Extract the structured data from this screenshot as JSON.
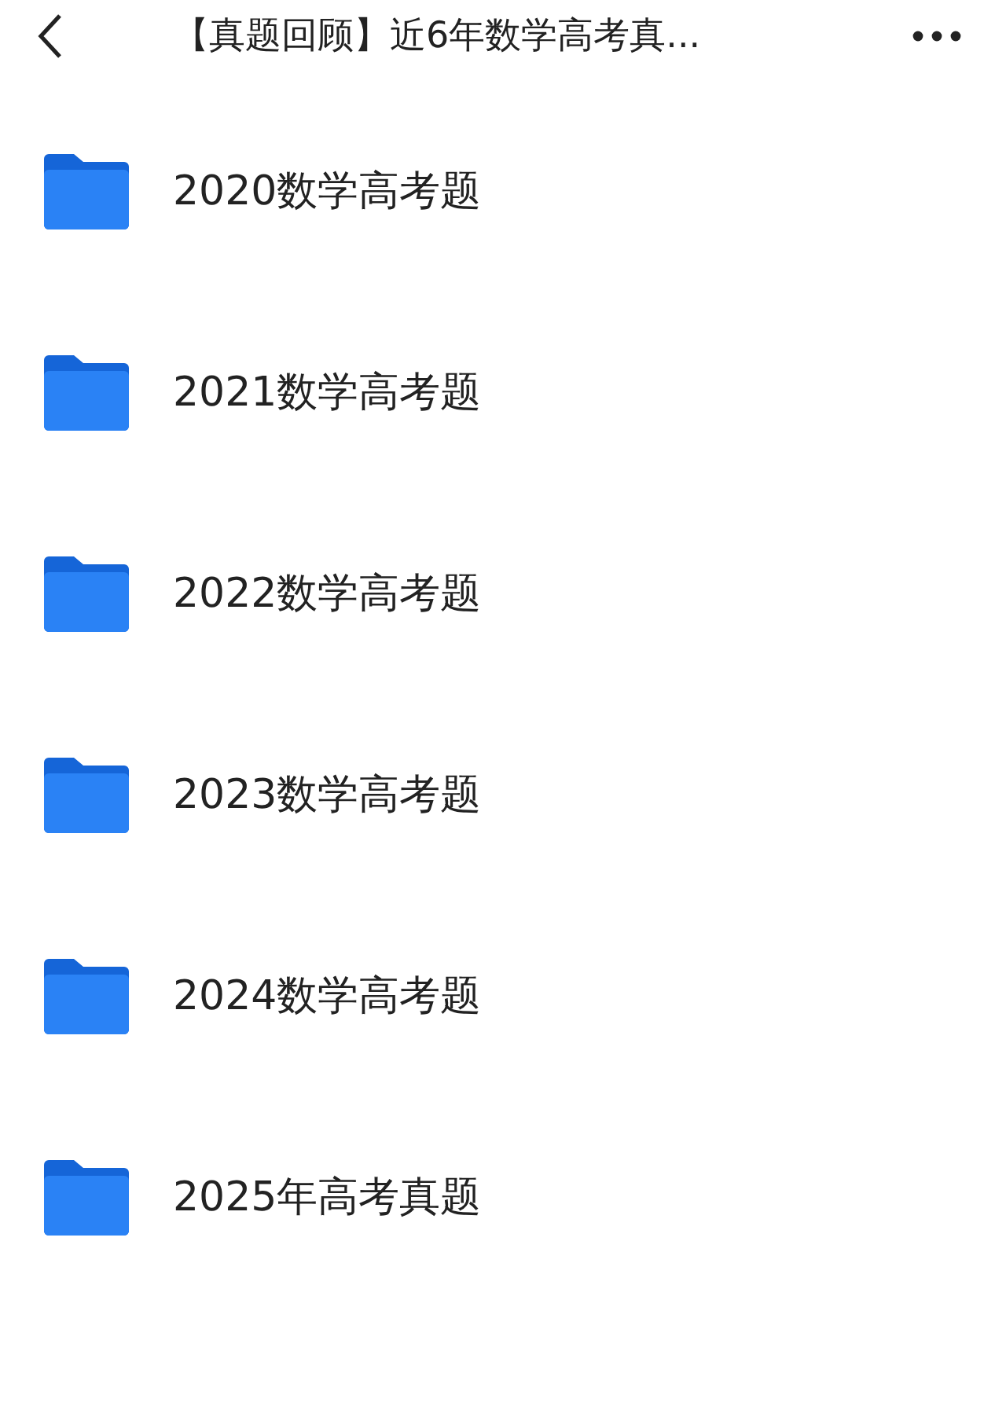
{
  "header": {
    "title": "【真题回顾】近6年数学高考真..."
  },
  "folders": [
    {
      "name": "2020数学高考题"
    },
    {
      "name": "2021数学高考题"
    },
    {
      "name": "2022数学高考题"
    },
    {
      "name": "2023数学高考题"
    },
    {
      "name": "2024数学高考题"
    },
    {
      "name": "2025年高考真题"
    }
  ]
}
